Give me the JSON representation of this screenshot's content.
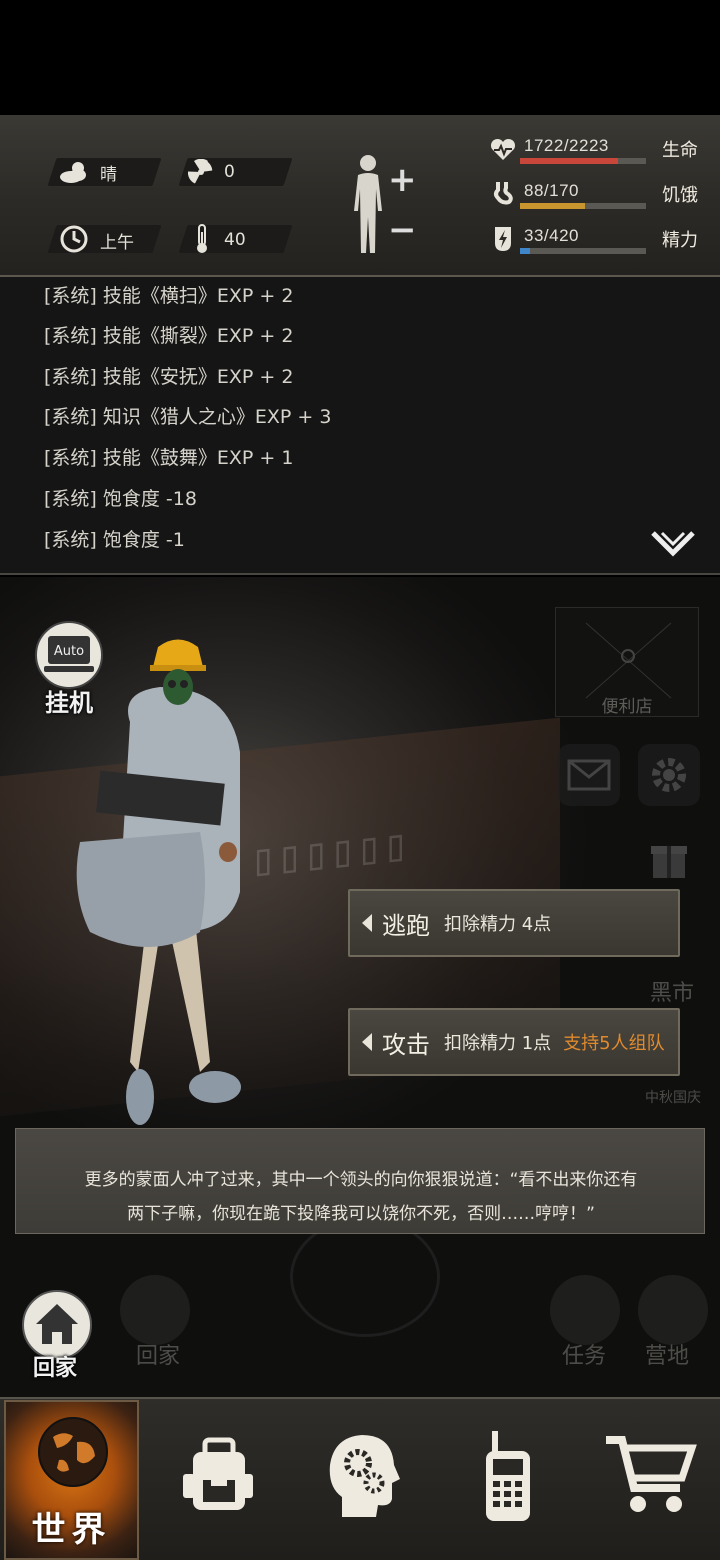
{
  "hud": {
    "weather": "晴",
    "radiation": "0",
    "time_of_day": "上午",
    "temperature": "40",
    "stats": [
      {
        "name": "生命",
        "value": "1722/2223",
        "fraction": 0.775,
        "color": "#c8473a",
        "icon": "heart-icon"
      },
      {
        "name": "饥饿",
        "value": "88/170",
        "fraction": 0.518,
        "color": "#c9952f",
        "icon": "stomach-icon"
      },
      {
        "name": "精力",
        "value": "33/420",
        "fraction": 0.079,
        "color": "#3f86c9",
        "icon": "energy-icon"
      }
    ]
  },
  "log": {
    "lines": [
      "[系统] 技能《横扫》EXP + 2",
      "[系统] 技能《撕裂》EXP + 2",
      "[系统] 技能《安抚》EXP + 2",
      "[系统] 知识《猎人之心》EXP + 3",
      "[系统] 技能《鼓舞》EXP + 1",
      "[系统] 饱食度 -18",
      "[系统] 饱食度 -1"
    ]
  },
  "scene": {
    "auto_icon_text": "Auto",
    "auto_label": "挂机",
    "map_label": "便利店",
    "black_market": "黑市",
    "festival": "中秋国庆",
    "home_faint": "回家",
    "task_label": "任务",
    "camp_label": "营地",
    "home_label": "回家"
  },
  "actions": [
    {
      "name": "逃跑",
      "desc": "扣除精力 4点",
      "extra": ""
    },
    {
      "name": "攻击",
      "desc": "扣除精力 1点",
      "extra": "支持5人组队"
    }
  ],
  "dialog": {
    "line1": "更多的蒙面人冲了过来，其中一个领头的向你狠狠说道：“看不出来你还有",
    "line2": "两下子嘛，你现在跪下投降我可以饶你不死，否则……哼哼！”"
  },
  "nav": {
    "active_label": "世界",
    "items": [
      "backpack-icon",
      "skills-icon",
      "radio-icon",
      "cart-icon"
    ]
  }
}
